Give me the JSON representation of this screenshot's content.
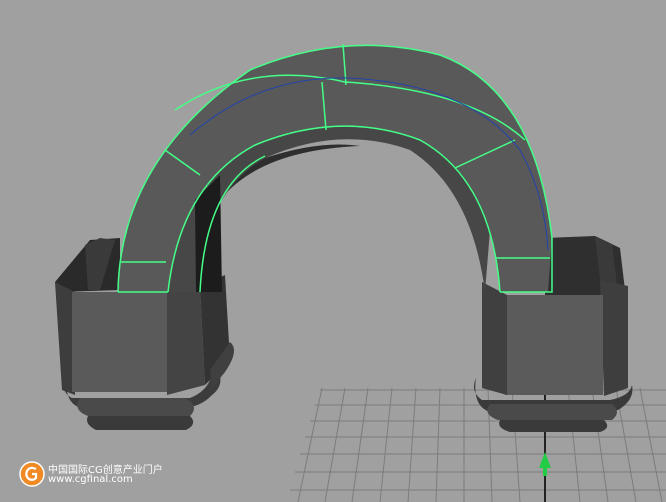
{
  "viewport": {
    "background_color": "#a0a0a0",
    "mesh_color": "#555555",
    "selection_highlight_color": "#44ff88",
    "grid_color": "#7c7c7c",
    "axis_arrow_color": "#22cc44"
  },
  "watermark": {
    "logo_icon": "cgfinal-logo",
    "line1": "中国国际CG创意产业门户",
    "line2": "www.cgfinal.com"
  }
}
